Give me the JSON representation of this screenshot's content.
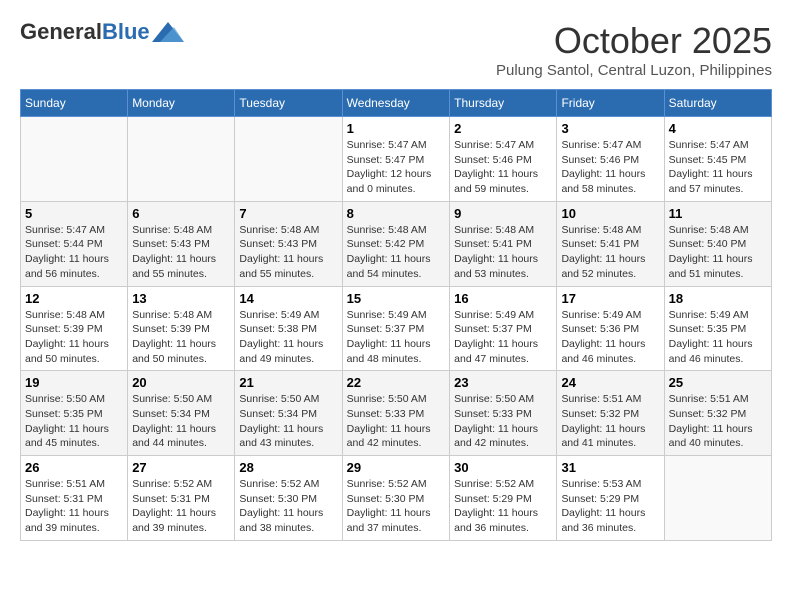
{
  "logo": {
    "general": "General",
    "blue": "Blue"
  },
  "title": "October 2025",
  "location": "Pulung Santol, Central Luzon, Philippines",
  "headers": [
    "Sunday",
    "Monday",
    "Tuesday",
    "Wednesday",
    "Thursday",
    "Friday",
    "Saturday"
  ],
  "weeks": [
    [
      {
        "day": "",
        "info": ""
      },
      {
        "day": "",
        "info": ""
      },
      {
        "day": "",
        "info": ""
      },
      {
        "day": "1",
        "info": "Sunrise: 5:47 AM\nSunset: 5:47 PM\nDaylight: 12 hours\nand 0 minutes."
      },
      {
        "day": "2",
        "info": "Sunrise: 5:47 AM\nSunset: 5:46 PM\nDaylight: 11 hours\nand 59 minutes."
      },
      {
        "day": "3",
        "info": "Sunrise: 5:47 AM\nSunset: 5:46 PM\nDaylight: 11 hours\nand 58 minutes."
      },
      {
        "day": "4",
        "info": "Sunrise: 5:47 AM\nSunset: 5:45 PM\nDaylight: 11 hours\nand 57 minutes."
      }
    ],
    [
      {
        "day": "5",
        "info": "Sunrise: 5:47 AM\nSunset: 5:44 PM\nDaylight: 11 hours\nand 56 minutes."
      },
      {
        "day": "6",
        "info": "Sunrise: 5:48 AM\nSunset: 5:43 PM\nDaylight: 11 hours\nand 55 minutes."
      },
      {
        "day": "7",
        "info": "Sunrise: 5:48 AM\nSunset: 5:43 PM\nDaylight: 11 hours\nand 55 minutes."
      },
      {
        "day": "8",
        "info": "Sunrise: 5:48 AM\nSunset: 5:42 PM\nDaylight: 11 hours\nand 54 minutes."
      },
      {
        "day": "9",
        "info": "Sunrise: 5:48 AM\nSunset: 5:41 PM\nDaylight: 11 hours\nand 53 minutes."
      },
      {
        "day": "10",
        "info": "Sunrise: 5:48 AM\nSunset: 5:41 PM\nDaylight: 11 hours\nand 52 minutes."
      },
      {
        "day": "11",
        "info": "Sunrise: 5:48 AM\nSunset: 5:40 PM\nDaylight: 11 hours\nand 51 minutes."
      }
    ],
    [
      {
        "day": "12",
        "info": "Sunrise: 5:48 AM\nSunset: 5:39 PM\nDaylight: 11 hours\nand 50 minutes."
      },
      {
        "day": "13",
        "info": "Sunrise: 5:48 AM\nSunset: 5:39 PM\nDaylight: 11 hours\nand 50 minutes."
      },
      {
        "day": "14",
        "info": "Sunrise: 5:49 AM\nSunset: 5:38 PM\nDaylight: 11 hours\nand 49 minutes."
      },
      {
        "day": "15",
        "info": "Sunrise: 5:49 AM\nSunset: 5:37 PM\nDaylight: 11 hours\nand 48 minutes."
      },
      {
        "day": "16",
        "info": "Sunrise: 5:49 AM\nSunset: 5:37 PM\nDaylight: 11 hours\nand 47 minutes."
      },
      {
        "day": "17",
        "info": "Sunrise: 5:49 AM\nSunset: 5:36 PM\nDaylight: 11 hours\nand 46 minutes."
      },
      {
        "day": "18",
        "info": "Sunrise: 5:49 AM\nSunset: 5:35 PM\nDaylight: 11 hours\nand 46 minutes."
      }
    ],
    [
      {
        "day": "19",
        "info": "Sunrise: 5:50 AM\nSunset: 5:35 PM\nDaylight: 11 hours\nand 45 minutes."
      },
      {
        "day": "20",
        "info": "Sunrise: 5:50 AM\nSunset: 5:34 PM\nDaylight: 11 hours\nand 44 minutes."
      },
      {
        "day": "21",
        "info": "Sunrise: 5:50 AM\nSunset: 5:34 PM\nDaylight: 11 hours\nand 43 minutes."
      },
      {
        "day": "22",
        "info": "Sunrise: 5:50 AM\nSunset: 5:33 PM\nDaylight: 11 hours\nand 42 minutes."
      },
      {
        "day": "23",
        "info": "Sunrise: 5:50 AM\nSunset: 5:33 PM\nDaylight: 11 hours\nand 42 minutes."
      },
      {
        "day": "24",
        "info": "Sunrise: 5:51 AM\nSunset: 5:32 PM\nDaylight: 11 hours\nand 41 minutes."
      },
      {
        "day": "25",
        "info": "Sunrise: 5:51 AM\nSunset: 5:32 PM\nDaylight: 11 hours\nand 40 minutes."
      }
    ],
    [
      {
        "day": "26",
        "info": "Sunrise: 5:51 AM\nSunset: 5:31 PM\nDaylight: 11 hours\nand 39 minutes."
      },
      {
        "day": "27",
        "info": "Sunrise: 5:52 AM\nSunset: 5:31 PM\nDaylight: 11 hours\nand 39 minutes."
      },
      {
        "day": "28",
        "info": "Sunrise: 5:52 AM\nSunset: 5:30 PM\nDaylight: 11 hours\nand 38 minutes."
      },
      {
        "day": "29",
        "info": "Sunrise: 5:52 AM\nSunset: 5:30 PM\nDaylight: 11 hours\nand 37 minutes."
      },
      {
        "day": "30",
        "info": "Sunrise: 5:52 AM\nSunset: 5:29 PM\nDaylight: 11 hours\nand 36 minutes."
      },
      {
        "day": "31",
        "info": "Sunrise: 5:53 AM\nSunset: 5:29 PM\nDaylight: 11 hours\nand 36 minutes."
      },
      {
        "day": "",
        "info": ""
      }
    ]
  ]
}
